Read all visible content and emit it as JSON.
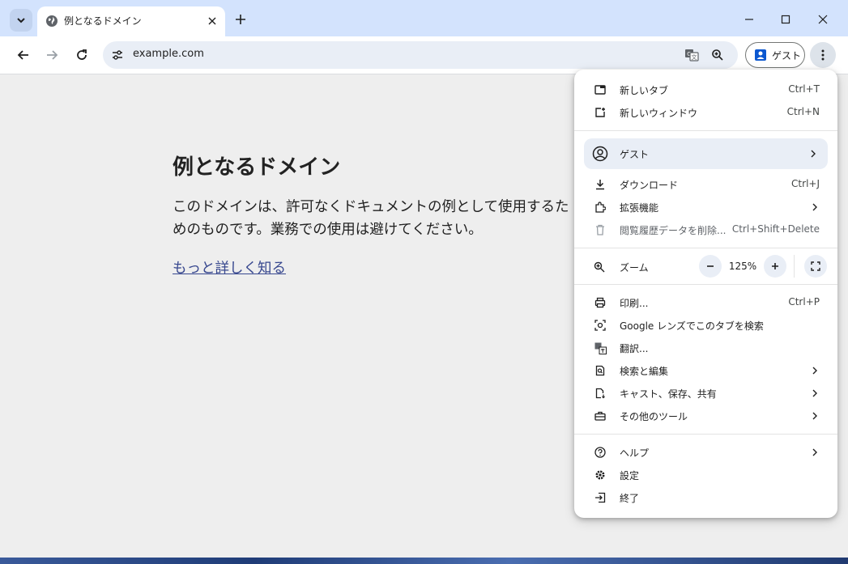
{
  "browser": {
    "tab": {
      "title": "例となるドメイン"
    },
    "omnibox": {
      "url": "example.com"
    },
    "profile": {
      "label": "ゲスト"
    }
  },
  "page": {
    "title": "例となるドメイン",
    "body": "このドメインは、許可なくドキュメントの例として使用するためのものです。業務での使用は避けてください。",
    "link": "もっと詳しく知る"
  },
  "menu": {
    "new_tab": {
      "label": "新しいタブ",
      "shortcut": "Ctrl+T"
    },
    "new_window": {
      "label": "新しいウィンドウ",
      "shortcut": "Ctrl+N"
    },
    "guest": {
      "label": "ゲスト"
    },
    "downloads": {
      "label": "ダウンロード",
      "shortcut": "Ctrl+J"
    },
    "extensions": {
      "label": "拡張機能"
    },
    "clear_data": {
      "label": "閲覧履歴データを削除...",
      "shortcut": "Ctrl+Shift+Delete"
    },
    "zoom": {
      "label": "ズーム",
      "value": "125%"
    },
    "print": {
      "label": "印刷...",
      "shortcut": "Ctrl+P"
    },
    "lens": {
      "label": "Google レンズでこのタブを検索"
    },
    "translate": {
      "label": "翻訳..."
    },
    "find_edit": {
      "label": "検索と編集"
    },
    "cast_save_share": {
      "label": "キャスト、保存、共有"
    },
    "more_tools": {
      "label": "その他のツール"
    },
    "help": {
      "label": "ヘルプ"
    },
    "settings": {
      "label": "設定"
    },
    "exit": {
      "label": "終了"
    }
  }
}
